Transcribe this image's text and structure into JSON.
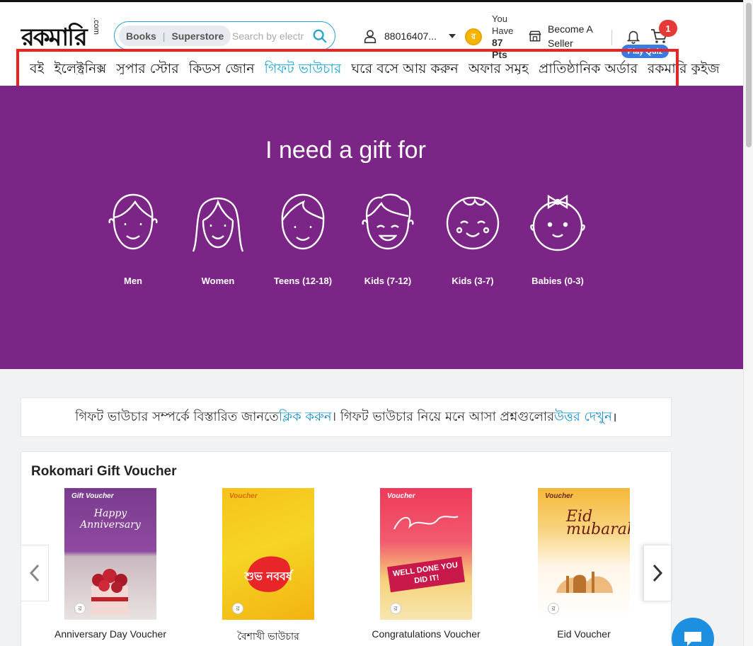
{
  "brand": {
    "logo_text": "রকমারি",
    "logo_suffix": ".com"
  },
  "search": {
    "tab_books": "Books",
    "tab_separator": "|",
    "tab_superstore": "Superstore",
    "placeholder": "Search by electr"
  },
  "user": {
    "phone": "88016407..."
  },
  "points": {
    "line1": "You",
    "line2": "Have",
    "value": "87",
    "unit": "Pts"
  },
  "seller": {
    "line1": "Become A",
    "line2": "Seller"
  },
  "cart": {
    "count": "1"
  },
  "quiz": {
    "label": "Play Quiz"
  },
  "nav": {
    "items": [
      {
        "label": "বই",
        "active": false
      },
      {
        "label": "ইলেক্ট্রনিক্স",
        "active": false
      },
      {
        "label": "সুপার স্টোর",
        "active": false
      },
      {
        "label": "কিডস জোন",
        "active": false
      },
      {
        "label": "গিফট ভাউচার",
        "active": true
      },
      {
        "label": "ঘরে বসে আয় করুন",
        "active": false
      },
      {
        "label": "অফার সমূহ",
        "active": false
      },
      {
        "label": "প্রাতিষ্ঠানিক অর্ডার",
        "active": false
      },
      {
        "label": "রকমারি কুইজ",
        "active": false
      }
    ]
  },
  "hero": {
    "title": "I need a gift for",
    "categories": [
      {
        "label": "Men"
      },
      {
        "label": "Women"
      },
      {
        "label": "Teens (12-18)"
      },
      {
        "label": "Kids (7-12)"
      },
      {
        "label": "Kids (3-7)"
      },
      {
        "label": "Babies (0-3)"
      }
    ]
  },
  "info": {
    "part1": "গিফট ভাউচার সম্পর্কে বিস্তারিত জানতে ",
    "link1": "ক্লিক করুন",
    "part2": "। গিফট ভাউচার নিয়ে মনে আসা প্রশ্নগুলোর ",
    "link2": "উত্তর দেখুন",
    "part3": "।"
  },
  "vouchers": {
    "title": "Rokomari Gift Voucher",
    "items": [
      {
        "label": "Anniversary Day Voucher",
        "tag": "Gift Voucher",
        "art": "Happy Anniversary"
      },
      {
        "label": "বৈশাখী ভাউচার",
        "tag": "Voucher",
        "art": "শুভ নববর্ষ"
      },
      {
        "label": "Congratulations Voucher",
        "tag": "Voucher",
        "art": "WELL DONE YOU DID IT!"
      },
      {
        "label": "Eid Voucher",
        "tag": "Voucher",
        "art": "Eid mubarak"
      }
    ]
  },
  "colors": {
    "accent": "#26a4c9",
    "hero_bg": "#7b2586",
    "active_nav": "#1aa6d6",
    "badge": "#e53935",
    "quiz": "#3a7be0"
  }
}
